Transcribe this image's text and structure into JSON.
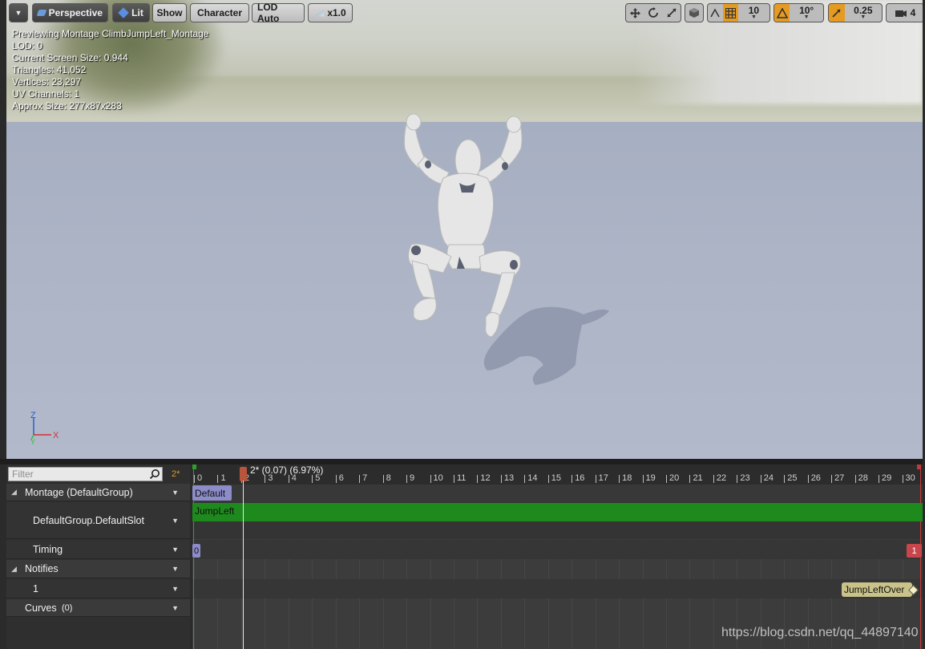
{
  "viewport": {
    "toolbar": {
      "menu_caret": "▼",
      "perspective_label": "Perspective",
      "lit_label": "Lit",
      "show_label": "Show",
      "character_label": "Character",
      "lod_label": "LOD Auto",
      "speed_label": "x1.0",
      "grid_snap_value": "10",
      "rotation_snap_value": "10°",
      "scale_snap_value": "0.25",
      "camera_speed_value": "4"
    },
    "info": {
      "line1": "Previewing Montage ClimbJumpLeft_Montage",
      "line2": "LOD: 0",
      "line3": "Current Screen Size: 0.944",
      "line4": "Triangles: 41,052",
      "line5": "Vertices: 23,297",
      "line6": "UV Channels: 1",
      "line7": "Approx Size: 277x87x283"
    },
    "axis": {
      "z": "Z",
      "x": "X",
      "y": "Y"
    }
  },
  "tracks": {
    "filter_placeholder": "Filter",
    "frame_indicator": "2*",
    "montage_label": "Montage (DefaultGroup)",
    "slot_label": "DefaultGroup.DefaultSlot",
    "timing_label": "Timing",
    "notifies_label": "Notifies",
    "notify_track_label": "1",
    "curves_label": "Curves",
    "curves_count": "(0)"
  },
  "timeline": {
    "scrub_label": "2* (0.07) (6.97%)",
    "ticks": [
      "0",
      "1",
      "2",
      "3",
      "4",
      "5",
      "6",
      "7",
      "8",
      "9",
      "10",
      "11",
      "12",
      "13",
      "14",
      "15",
      "16",
      "17",
      "18",
      "19",
      "20",
      "21",
      "22",
      "23",
      "24",
      "25",
      "26",
      "27",
      "28",
      "29",
      "30"
    ],
    "section_label": "Default",
    "segment_label": "JumpLeft",
    "timing_start": "0",
    "timing_end": "1",
    "notify_label": "JumpLeftOver",
    "watermark": "https://blog.csdn.net/qq_44897140"
  },
  "colors": {
    "segment_green": "#1e8a1e",
    "section_purple": "#8c8cc8",
    "timing_red": "#c8454b",
    "notify_tan": "#c9c38a",
    "accent_orange": "#e59b22"
  }
}
